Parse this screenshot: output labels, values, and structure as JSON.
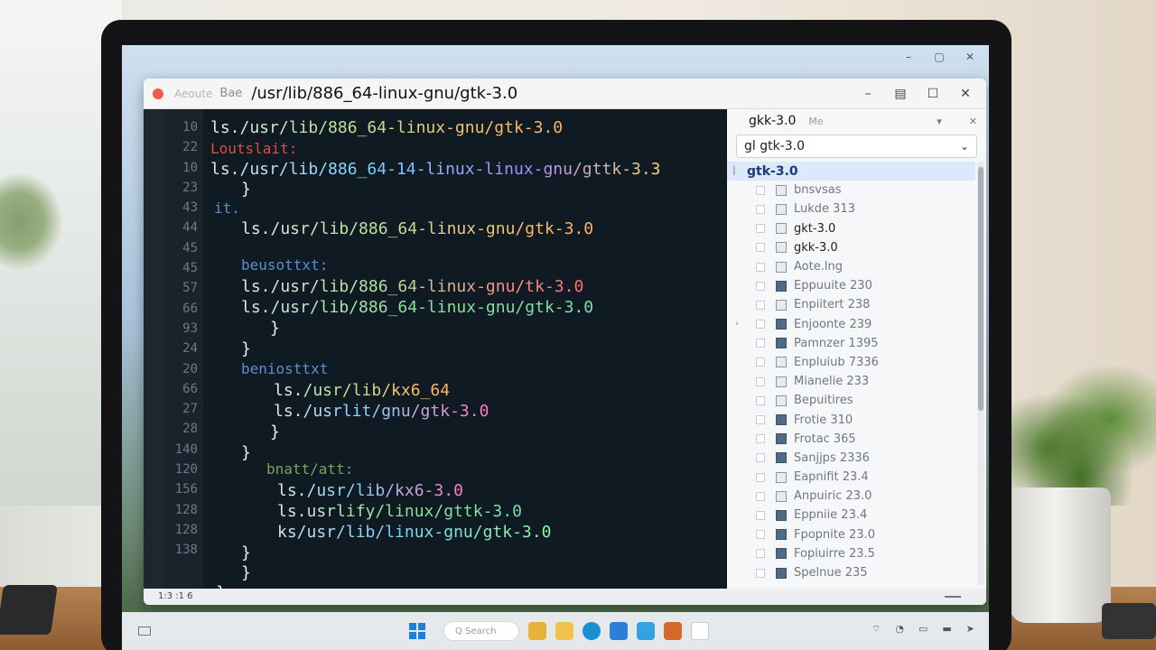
{
  "window": {
    "app_name": "Aeoute",
    "app_sub": "Bae",
    "title": "/usr/lib/886_64-linux-gnu/gtk-3.0"
  },
  "editor": {
    "gutter": [
      "10",
      "22",
      "10",
      "23",
      "43",
      "44",
      "45",
      "45",
      "57",
      "66",
      "93",
      "24",
      "20",
      "66",
      "27",
      "28",
      "140",
      "120",
      "156",
      "128",
      "128",
      "138"
    ],
    "lines": [
      {
        "text": "ls./usr/lib/886_64-linux-gnu/gtk-3.0",
        "style": "c-grad"
      },
      {
        "text": "Loutslait:",
        "style": "c-red"
      },
      {
        "text": "ls./usr/lib/886_64-14-linux-linux-gnu/gttk-3.3",
        "style": "c-grad2"
      },
      {
        "text": "}",
        "style": "c-brace"
      },
      {
        "text": "it.",
        "style": "c-blue"
      },
      {
        "text": "ls./usr/lib/886_64-linux-gnu/gtk-3.0",
        "style": "c-grad"
      },
      {
        "text": "beusottxt:",
        "style": "c-blue"
      },
      {
        "text": "ls./usr/lib/886_64-linux-gnu/tk-3.0",
        "style": "c-grad3"
      },
      {
        "text": "ls./usr/lib/886_64-linux-gnu/gtk-3.0",
        "style": "c-grad4"
      },
      {
        "text": "}",
        "style": "c-brace"
      },
      {
        "text": "}",
        "style": "c-brace"
      },
      {
        "text": "beniosttxt",
        "style": "c-blue"
      },
      {
        "text": "ls./usr/lib/kx6_64",
        "style": "c-grad"
      },
      {
        "text": "ls./usrlit/gnu/gtk-3.0",
        "style": "c-grad5"
      },
      {
        "text": "}",
        "style": "c-brace"
      },
      {
        "text": "}",
        "style": "c-brace"
      },
      {
        "text": "bnatt/att:",
        "style": "c-green"
      },
      {
        "text": "ls./usr/lib/kx6-3.0",
        "style": "c-grad5"
      },
      {
        "text": "ls.usrlify/linux/gttk-3.0",
        "style": "c-grad4"
      },
      {
        "text": "ks/usr/lib/linux-gnu/gtk-3.0",
        "style": "c-grad6"
      },
      {
        "text": "}",
        "style": "c-brace"
      },
      {
        "text": "}",
        "style": "c-brace"
      },
      {
        "text": "}",
        "style": "c-brace"
      }
    ],
    "status": "1:3 :1 6"
  },
  "panel": {
    "title": "gkk-3.0",
    "title_muted": "Me",
    "select_value": "gl gtk-3.0",
    "selected_item": "gtk-3.0",
    "items": [
      "bnsvsas",
      "Lukde 313",
      "gkt-3.0",
      "gkk-3.0",
      "Aote.lng",
      "Eppuuite 230",
      "Enpiitert 238",
      "Enjoonte 239",
      "Pamnzer 1395",
      "Enpluiub 7336",
      "Mianelie 233",
      "Bepuitires",
      "Frotie 310",
      "Frotac 365",
      "Sanjjps 2336",
      "Eapnifit 23.4",
      "Anpuiric 23.0",
      "Eppniie 23.4",
      "Fpopnite 23.0",
      "Fopiuirre 23.5",
      "Spelnue 235"
    ]
  },
  "taskbar": {
    "search_placeholder": "Q Search"
  }
}
